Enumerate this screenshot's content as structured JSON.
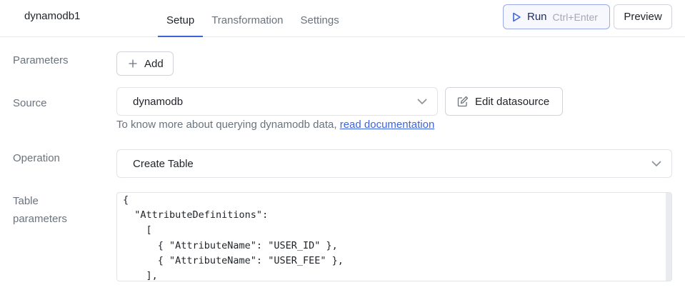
{
  "header": {
    "query_name": "dynamodb1",
    "tabs": [
      {
        "label": "Setup",
        "active": true
      },
      {
        "label": "Transformation",
        "active": false
      },
      {
        "label": "Settings",
        "active": false
      }
    ],
    "run_label": "Run",
    "run_shortcut": "Ctrl+Enter",
    "preview_label": "Preview"
  },
  "form": {
    "parameters_label": "Parameters",
    "add_label": "Add",
    "source_label": "Source",
    "source_value": "dynamodb",
    "edit_datasource_label": "Edit datasource",
    "help_text": "To know more about querying dynamodb data, ",
    "help_link": "read documentation",
    "operation_label": "Operation",
    "operation_value": "Create Table",
    "table_params_label_1": "Table",
    "table_params_label_2": "parameters"
  },
  "editor": {
    "lines": [
      "{",
      "  \"AttributeDefinitions\":",
      "    [",
      "      { \"AttributeName\": \"USER_ID\" },",
      "      { \"AttributeName\": \"USER_FEE\" },",
      "    ],"
    ]
  },
  "colors": {
    "accent": "#3e63dd",
    "muted_text": "#6a737d",
    "border": "#e1e4e8"
  }
}
